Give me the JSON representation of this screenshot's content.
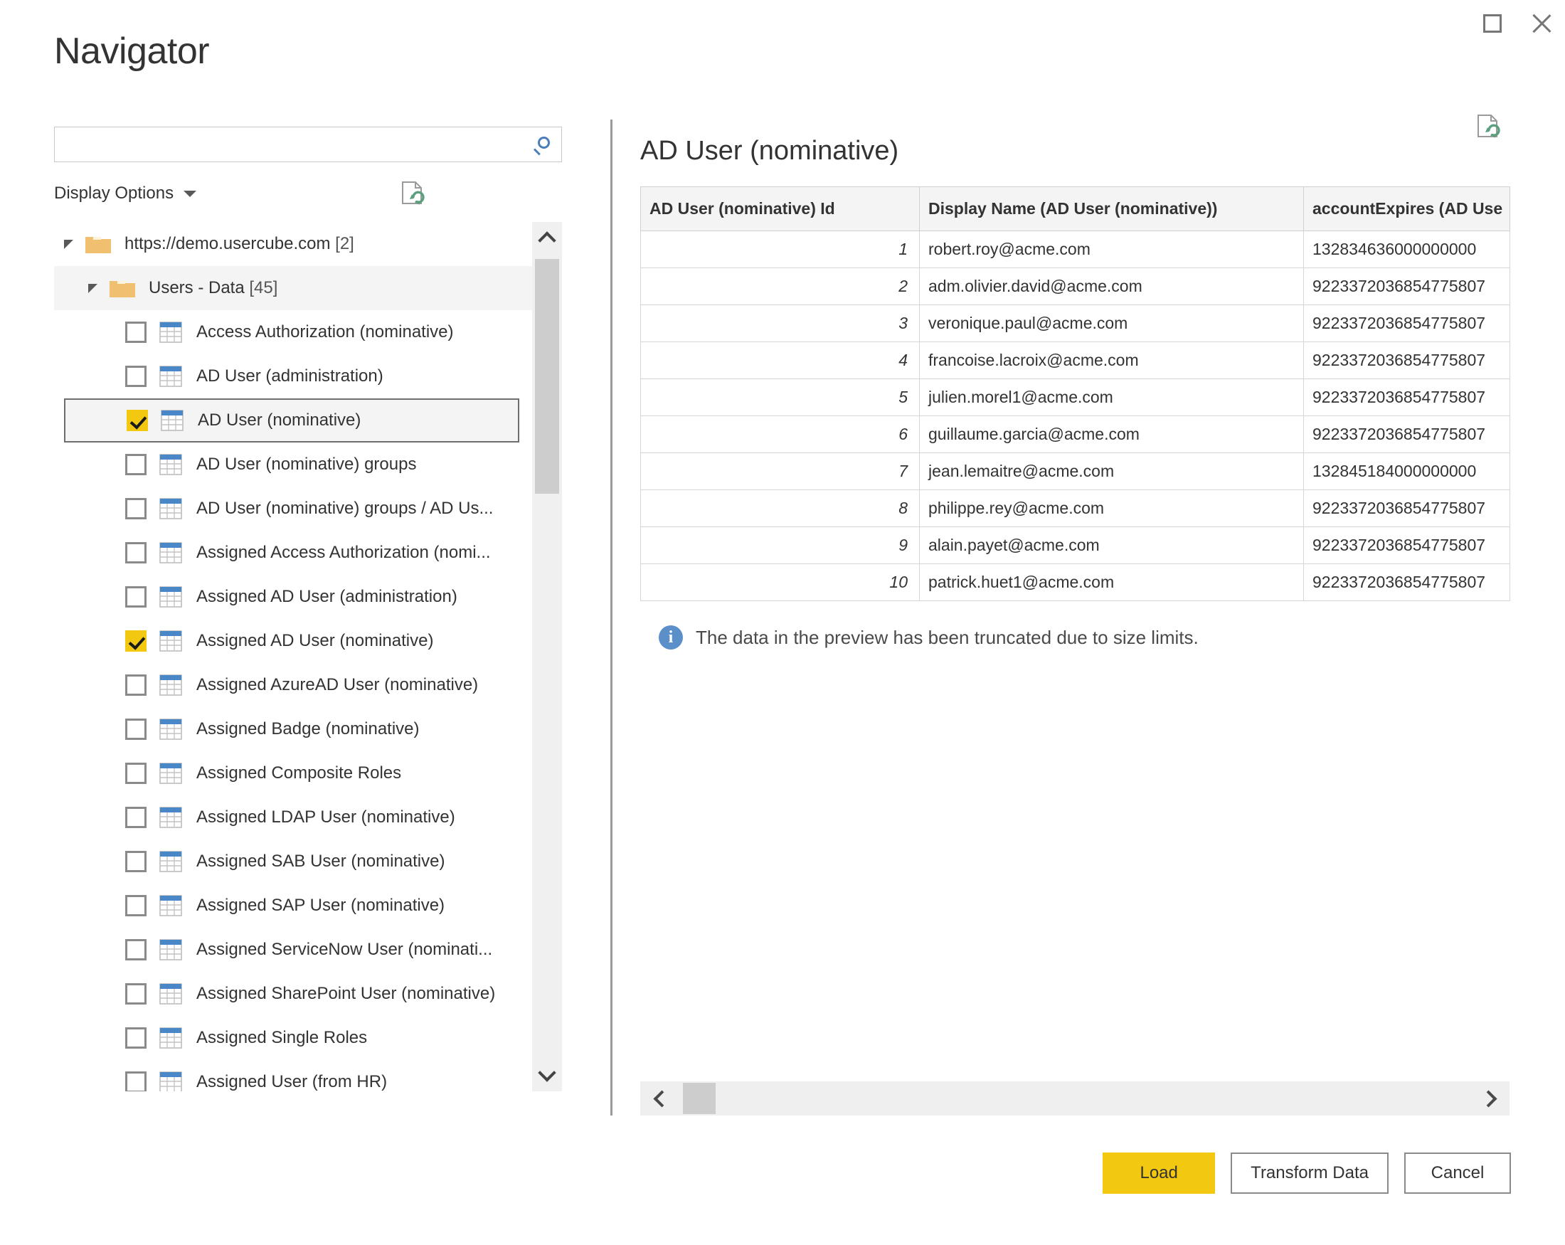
{
  "window": {
    "maximize_label": "Maximize",
    "close_label": "Close"
  },
  "dialog": {
    "title": "Navigator"
  },
  "search": {
    "value": "",
    "placeholder": "",
    "icon": "search-icon"
  },
  "display_options": {
    "label": "Display Options",
    "caret_icon": "chevron-down-icon",
    "refresh_icon": "document-refresh-icon"
  },
  "tree": {
    "nodes": [
      {
        "type": "group",
        "depth": 0,
        "label": "https://demo.usercube.com",
        "count": "[2]",
        "expanded": true,
        "icon": "folder-icon"
      },
      {
        "type": "group",
        "depth": 1,
        "label": "Users - Data",
        "count": "[45]",
        "expanded": true,
        "icon": "folder-icon"
      },
      {
        "type": "leaf",
        "label": "Access Authorization (nominative)",
        "checked": false,
        "selected": false,
        "icon": "table-icon"
      },
      {
        "type": "leaf",
        "label": "AD User (administration)",
        "checked": false,
        "selected": false,
        "icon": "table-icon"
      },
      {
        "type": "leaf",
        "label": "AD User (nominative)",
        "checked": true,
        "selected": true,
        "icon": "table-icon"
      },
      {
        "type": "leaf",
        "label": "AD User (nominative) groups",
        "checked": false,
        "selected": false,
        "icon": "table-icon"
      },
      {
        "type": "leaf",
        "label": "AD User (nominative) groups / AD Us...",
        "checked": false,
        "selected": false,
        "icon": "table-icon"
      },
      {
        "type": "leaf",
        "label": "Assigned Access Authorization (nomi...",
        "checked": false,
        "selected": false,
        "icon": "table-icon"
      },
      {
        "type": "leaf",
        "label": "Assigned AD User (administration)",
        "checked": false,
        "selected": false,
        "icon": "table-icon"
      },
      {
        "type": "leaf",
        "label": "Assigned AD User (nominative)",
        "checked": true,
        "selected": false,
        "icon": "table-icon"
      },
      {
        "type": "leaf",
        "label": "Assigned AzureAD User (nominative)",
        "checked": false,
        "selected": false,
        "icon": "table-icon"
      },
      {
        "type": "leaf",
        "label": "Assigned Badge (nominative)",
        "checked": false,
        "selected": false,
        "icon": "table-icon"
      },
      {
        "type": "leaf",
        "label": "Assigned Composite Roles",
        "checked": false,
        "selected": false,
        "icon": "table-icon"
      },
      {
        "type": "leaf",
        "label": "Assigned LDAP User (nominative)",
        "checked": false,
        "selected": false,
        "icon": "table-icon"
      },
      {
        "type": "leaf",
        "label": "Assigned SAB User (nominative)",
        "checked": false,
        "selected": false,
        "icon": "table-icon"
      },
      {
        "type": "leaf",
        "label": "Assigned SAP User (nominative)",
        "checked": false,
        "selected": false,
        "icon": "table-icon"
      },
      {
        "type": "leaf",
        "label": "Assigned ServiceNow User (nominati...",
        "checked": false,
        "selected": false,
        "icon": "table-icon"
      },
      {
        "type": "leaf",
        "label": "Assigned SharePoint User (nominative)",
        "checked": false,
        "selected": false,
        "icon": "table-icon"
      },
      {
        "type": "leaf",
        "label": "Assigned Single Roles",
        "checked": false,
        "selected": false,
        "icon": "table-icon"
      },
      {
        "type": "leaf",
        "label": "Assigned User (from HR)",
        "checked": false,
        "selected": false,
        "icon": "table-icon"
      }
    ]
  },
  "preview": {
    "title": "AD User (nominative)",
    "refresh_icon": "document-refresh-icon",
    "columns": [
      "AD User (nominative) Id",
      "Display Name (AD User (nominative))",
      "accountExpires (AD Use"
    ],
    "rows": [
      {
        "id": "1",
        "display_name": "robert.roy@acme.com",
        "account_expires": "132834636000000000"
      },
      {
        "id": "2",
        "display_name": "adm.olivier.david@acme.com",
        "account_expires": "9223372036854775807"
      },
      {
        "id": "3",
        "display_name": "veronique.paul@acme.com",
        "account_expires": "9223372036854775807"
      },
      {
        "id": "4",
        "display_name": "francoise.lacroix@acme.com",
        "account_expires": "9223372036854775807"
      },
      {
        "id": "5",
        "display_name": "julien.morel1@acme.com",
        "account_expires": "9223372036854775807"
      },
      {
        "id": "6",
        "display_name": "guillaume.garcia@acme.com",
        "account_expires": "9223372036854775807"
      },
      {
        "id": "7",
        "display_name": "jean.lemaitre@acme.com",
        "account_expires": "132845184000000000"
      },
      {
        "id": "8",
        "display_name": "philippe.rey@acme.com",
        "account_expires": "9223372036854775807"
      },
      {
        "id": "9",
        "display_name": "alain.payet@acme.com",
        "account_expires": "9223372036854775807"
      },
      {
        "id": "10",
        "display_name": "patrick.huet1@acme.com",
        "account_expires": "9223372036854775807"
      }
    ],
    "truncation_message": "The data in the preview has been truncated due to size limits.",
    "info_glyph": "i"
  },
  "footer": {
    "load_label": "Load",
    "transform_label": "Transform Data",
    "cancel_label": "Cancel"
  },
  "colors": {
    "accent_yellow": "#f2c811",
    "info_blue": "#5b8fc9",
    "folder_tan": "#f0c070",
    "table_header_blue": "#4a87c8",
    "search_icon_blue": "#4a7ebb"
  }
}
